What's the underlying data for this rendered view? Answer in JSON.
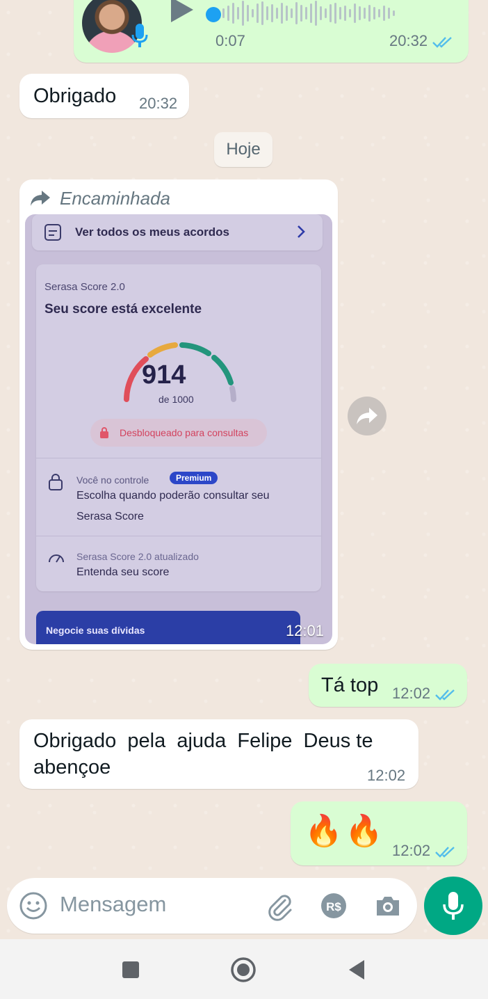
{
  "voice_message": {
    "duration": "0:07",
    "time": "20:32"
  },
  "messages": {
    "obrigado": {
      "text": "Obrigado",
      "time": "20:32"
    },
    "date_chip": "Hoje",
    "forwarded": {
      "label": "Encaminhada",
      "time": "12:01",
      "image": {
        "agreements_link": "Ver todos os meus acordos",
        "score_title": "Serasa Score 2.0",
        "score_status": "Seu score está excelente",
        "score_value": "914",
        "score_max": "de 1000",
        "unlock_label": "Desbloqueado para consultas",
        "control_title": "Você no controle",
        "premium_badge": "Premium",
        "control_desc_1": "Escolha quando poderão consultar seu",
        "control_desc_2": "Serasa Score",
        "updated_title": "Serasa Score 2.0 atualizado",
        "updated_desc": "Entenda seu score",
        "negotiate": "Negocie suas dívidas",
        "score_progress": 0.914
      }
    },
    "tatop": {
      "text": "Tá top",
      "time": "12:02"
    },
    "obrigado2": {
      "line1": "Obrigado  pela  ajuda  Felipe  Deus te",
      "line2": "abençoe",
      "time": "12:02"
    },
    "fire": {
      "emoji": "🔥",
      "time": "12:02"
    }
  },
  "input": {
    "placeholder": "Mensagem"
  },
  "icons": {
    "emoji": "emoji-icon",
    "attach": "paperclip-icon",
    "payment": "rs-payment-icon",
    "camera": "camera-icon",
    "mic": "mic-icon",
    "nav_recents": "square-icon",
    "nav_home": "circle-icon",
    "nav_back": "triangle-back-icon"
  },
  "colors": {
    "outgoing_bubble": "#d9fdd3",
    "incoming_bubble": "#ffffff",
    "read_ticks": "#53bdeb",
    "accent": "#00a884"
  }
}
